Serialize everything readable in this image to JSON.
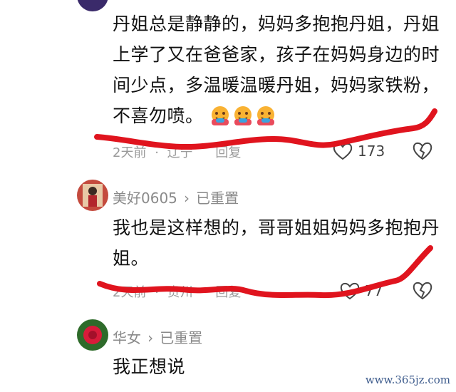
{
  "comments": [
    {
      "text": "丹姐总是静静的，妈妈多抱抱丹姐，丹姐上学了又在爸爸家，孩子在妈妈身边的时间少点，多温暖温暖丹姐，妈妈家铁粉，不喜勿喷。",
      "emoji_count": 3,
      "time": "2天前",
      "location": "辽宁",
      "reply_label": "回复",
      "likes": "173"
    },
    {
      "username": "美好0605",
      "badge": "已重置",
      "text": "我也是这样想的，哥哥姐姐妈妈多抱抱丹姐。",
      "time": "2天前",
      "location": "贵州",
      "reply_label": "回复",
      "likes": "77"
    },
    {
      "username": "华女",
      "badge": "已重置",
      "text": "我正想说"
    }
  ],
  "watermark": "www.365jz.com",
  "colors": {
    "annotation": "#e0141e",
    "meta": "#9a9a9a"
  }
}
